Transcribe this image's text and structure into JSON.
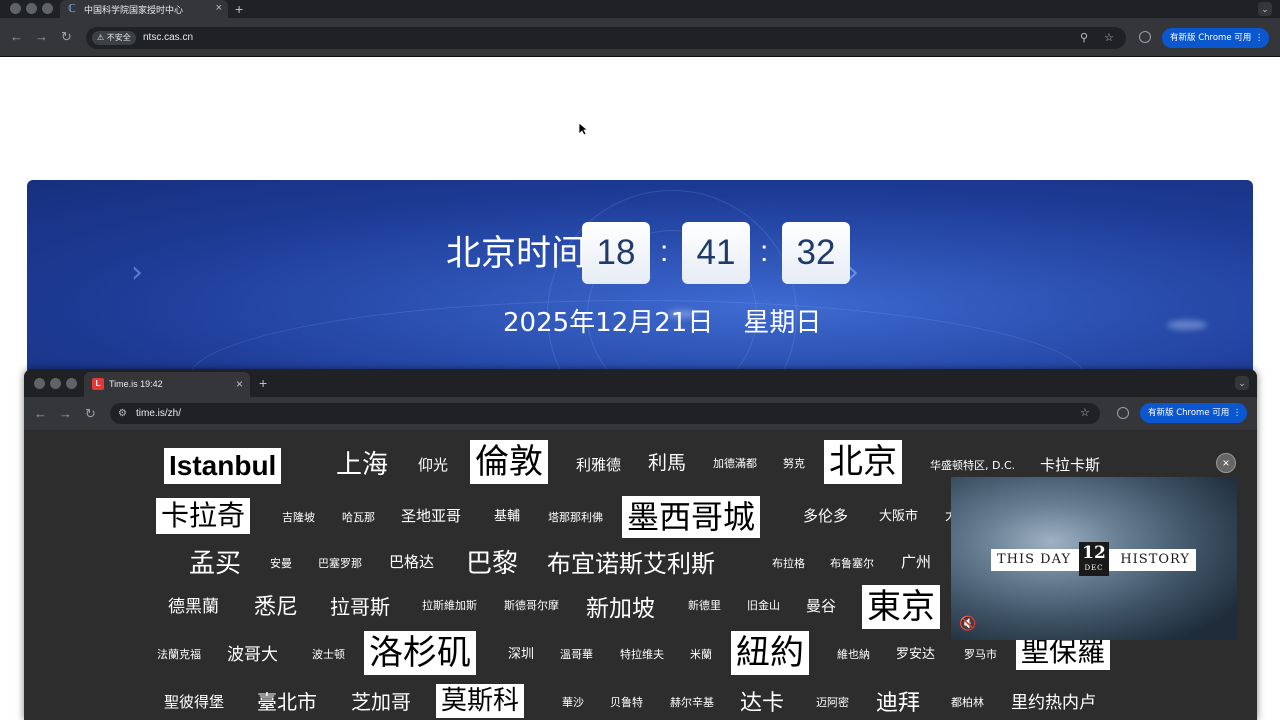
{
  "outer_browser": {
    "tab_title": "中国科学院国家授时中心",
    "security_label": "不安全",
    "url": "ntsc.cas.cn",
    "update_label": "有新版 Chrome 可用"
  },
  "banner": {
    "label": "北京时间:",
    "hours": "18",
    "minutes": "41",
    "seconds": "32",
    "separator": ":",
    "date": "2025年12月21日",
    "weekday": "星期日"
  },
  "inner_browser": {
    "tab_title": "Time.is 19:42",
    "url": "time.is/zh/",
    "update_label": "有新版 Chrome 可用"
  },
  "cities": [
    {
      "name": "Istanbul",
      "hl": true,
      "size": 28,
      "bold": true
    },
    {
      "name": "上海",
      "size": 26
    },
    {
      "name": "仰光",
      "size": 15
    },
    {
      "name": "倫敦",
      "hl": true,
      "size": 34
    },
    {
      "name": "利雅德",
      "size": 15
    },
    {
      "name": "利馬",
      "size": 19
    },
    {
      "name": "加德滿都",
      "size": 11
    },
    {
      "name": "努克",
      "size": 11
    },
    {
      "name": "北京",
      "hl": true,
      "size": 34
    },
    {
      "name": "华盛顿特区, D.C.",
      "size": 11
    },
    {
      "name": "卡拉卡斯",
      "size": 15
    },
    {
      "name": "卡拉奇",
      "hl": true,
      "size": 28
    },
    {
      "name": "吉隆坡",
      "size": 11
    },
    {
      "name": "哈瓦那",
      "size": 11
    },
    {
      "name": "圣地亚哥",
      "size": 15
    },
    {
      "name": "基輔",
      "size": 13
    },
    {
      "name": "塔那那利佛",
      "size": 11
    },
    {
      "name": "墨西哥城",
      "hl": true,
      "size": 32
    },
    {
      "name": "多伦多",
      "size": 15
    },
    {
      "name": "大阪市",
      "size": 13
    },
    {
      "name": "大",
      "size": 13
    },
    {
      "name": "孟买",
      "size": 26
    },
    {
      "name": "安曼",
      "size": 11
    },
    {
      "name": "巴塞罗那",
      "size": 11
    },
    {
      "name": "巴格达",
      "size": 15
    },
    {
      "name": "巴黎",
      "size": 26
    },
    {
      "name": "布宜诺斯艾利斯",
      "size": 24
    },
    {
      "name": "布拉格",
      "size": 11
    },
    {
      "name": "布鲁塞尔",
      "size": 11
    },
    {
      "name": "广州",
      "size": 15
    },
    {
      "name": "德黑蘭",
      "size": 17
    },
    {
      "name": "悉尼",
      "size": 22
    },
    {
      "name": "拉哥斯",
      "size": 20
    },
    {
      "name": "拉斯維加斯",
      "size": 11
    },
    {
      "name": "斯德哥尔摩",
      "size": 11
    },
    {
      "name": "新加坡",
      "size": 23
    },
    {
      "name": "新德里",
      "size": 11
    },
    {
      "name": "旧金山",
      "size": 11
    },
    {
      "name": "曼谷",
      "size": 15
    },
    {
      "name": "東京",
      "hl": true,
      "size": 34
    },
    {
      "name": "法蘭克福",
      "size": 11
    },
    {
      "name": "波哥大",
      "size": 17
    },
    {
      "name": "波士顿",
      "size": 11
    },
    {
      "name": "洛杉矶",
      "hl": true,
      "size": 34
    },
    {
      "name": "深圳",
      "size": 13
    },
    {
      "name": "溫哥華",
      "size": 11
    },
    {
      "name": "特拉维夫",
      "size": 11
    },
    {
      "name": "米蘭",
      "size": 11
    },
    {
      "name": "紐約",
      "hl": true,
      "size": 34
    },
    {
      "name": "維也納",
      "size": 11
    },
    {
      "name": "罗安达",
      "size": 13
    },
    {
      "name": "罗马市",
      "size": 11
    },
    {
      "name": "聖保羅",
      "hl": true,
      "size": 28
    },
    {
      "name": "聖彼得堡",
      "size": 15
    },
    {
      "name": "臺北市",
      "size": 20
    },
    {
      "name": "芝加哥",
      "size": 20
    },
    {
      "name": "莫斯科",
      "hl": true,
      "size": 26
    },
    {
      "name": "華沙",
      "size": 11
    },
    {
      "name": "贝鲁特",
      "size": 11
    },
    {
      "name": "赫尔辛基",
      "size": 11
    },
    {
      "name": "达卡",
      "size": 22
    },
    {
      "name": "迈阿密",
      "size": 11
    },
    {
      "name": "迪拜",
      "size": 22
    },
    {
      "name": "都柏林",
      "size": 11
    },
    {
      "name": "里约热内卢",
      "size": 17
    }
  ],
  "video": {
    "title_left": "THIS DAY",
    "day": "12",
    "month": "DEC",
    "title_right": "HISTORY"
  },
  "icons": {
    "close": "×",
    "new_tab": "+",
    "menu": "⋮",
    "mute": "🔇"
  }
}
